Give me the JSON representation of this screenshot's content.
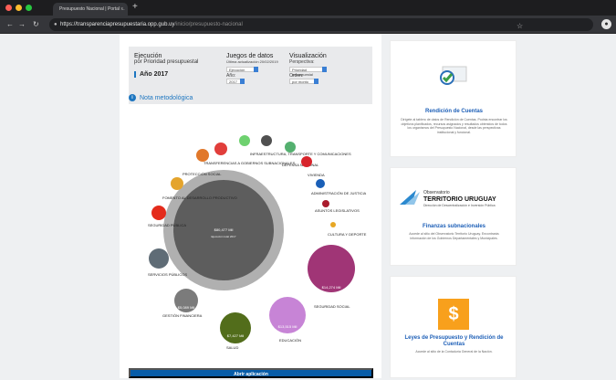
{
  "browser": {
    "tab_title": "Presupuesto Nacional | Portal ...",
    "url_base": "https://transparenciapresupuestaria.opp.gub.uy",
    "url_path": "/inicio/presupuesto-nacional"
  },
  "filters": {
    "title_line1": "Ejecución",
    "title_line2": "por Prioridad presupuestal",
    "year_label": "Año",
    "year_value": "2017",
    "datasets_title": "Juegos de datos",
    "updated": "Última actualización 20/02/2019",
    "dataset_select": "Ejecución",
    "year_field_label": "Año:",
    "year_select": "2017",
    "viz_title": "Visualización",
    "perspective_label": "Perspectiva:",
    "perspective_select": "Prioridad presupuestal",
    "order_label": "Orden:",
    "order_select": "por monto"
  },
  "note": {
    "label": "Nota metodológica"
  },
  "viz": {
    "center_amount": "$80,477 Mil",
    "center_caption": "Ejecución total 2017",
    "categories": [
      {
        "label": "INFRAESTRUCTURA, TRANSPORTE Y COMUNICACIONES",
        "icon": "road-icon"
      },
      {
        "label": "DEFENSA NACIONAL",
        "icon": "shield-icon"
      },
      {
        "label": "VIVIENDA",
        "icon": "house-icon"
      },
      {
        "label": "ADMINISTRACIÓN DE JUSTICIA",
        "icon": "scale-icon"
      },
      {
        "label": "ASUNTOS LEGISLATIVOS",
        "icon": "parliament-icon"
      },
      {
        "label": "CULTURA Y DEPORTE",
        "icon": "sport-icon"
      },
      {
        "label": "SEGURIDAD SOCIAL",
        "icon": "family-icon",
        "amount": "$14,274 Mil"
      },
      {
        "label": "EDUCACIÓN",
        "icon": "student-icon",
        "amount": "$13,515 Mil"
      },
      {
        "label": "SALUD",
        "icon": "health-icon",
        "amount": "$7,427 Mil"
      },
      {
        "label": "GESTIÓN FINANCIERA",
        "icon": "finance-icon",
        "amount": "$5,089 Mil"
      },
      {
        "label": "SERVICIOS PÚBLICOS",
        "icon": "services-icon"
      },
      {
        "label": "SEGURIDAD PÚBLICA",
        "icon": "police-icon"
      },
      {
        "label": "FOMENTO AL DESARROLLO PRODUCTIVO",
        "icon": "growth-icon"
      },
      {
        "label": "PROTECCIÓN SOCIAL",
        "icon": "care-icon"
      },
      {
        "label": "TRANSFERENCIAS A GOBIERNOS SUBNACIONALES",
        "icon": "transfer-icon"
      }
    ]
  },
  "cta": {
    "label": "Abrir aplicación"
  },
  "cards": [
    {
      "title": "Rendición de Cuentas",
      "text": "Dirígete al tablero de datos de Rendición de Cuentas. Podrás encontrar los objetivos planificados, recursos asignados y resultados obtenidos de todos los organismos del Presupuesto Nacional, desde las perspectivas institucional y funcional."
    },
    {
      "logo_small": "Observatorio",
      "logo_big": "TERRITORIO URUGUAY",
      "logo_sub": "Dirección de Descentralización e Inversión Pública",
      "title": "Finanzas subnacionales",
      "text": "Accede al sitio del Observatorio Territorio Uruguay. Encontrarás información de los Gobiernos Departamentales y Municipales."
    },
    {
      "title": "Leyes de Presupuesto y Rendición de Cuentas",
      "text": "Accede al sitio de la Contaduría General de la Nación."
    }
  ]
}
